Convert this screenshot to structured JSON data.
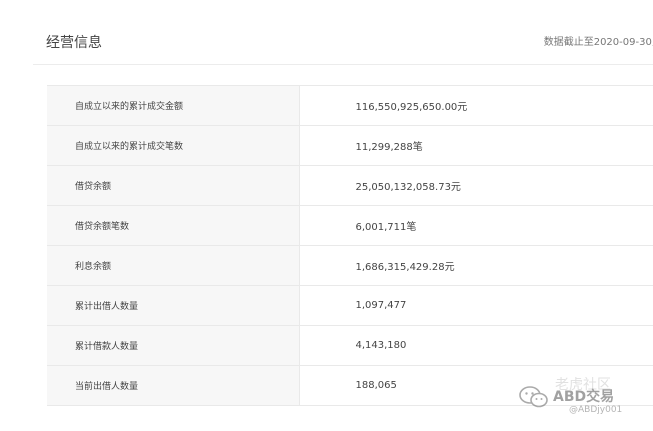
{
  "header": {
    "title": "经营信息",
    "date_note": "数据截止至2020-09-30,"
  },
  "rows": [
    {
      "label": "自成立以来的累计成交金额",
      "value": "116,550,925,650.00元"
    },
    {
      "label": "自成立以来的累计成交笔数",
      "value": "11,299,288笔"
    },
    {
      "label": "借贷余额",
      "value": "25,050,132,058.73元"
    },
    {
      "label": "借贷余额笔数",
      "value": "6,001,711笔"
    },
    {
      "label": "利息余额",
      "value": "1,686,315,429.28元"
    },
    {
      "label": "累计出借人数量",
      "value": "1,097,477"
    },
    {
      "label": "累计借款人数量",
      "value": "4,143,180"
    },
    {
      "label": "当前出借人数量",
      "value": "188,065"
    }
  ],
  "watermark": {
    "faint_text": "老虎社区",
    "main_text": "ABD交易",
    "handle": "@ABDjy001",
    "icon": "wechat-icon"
  }
}
